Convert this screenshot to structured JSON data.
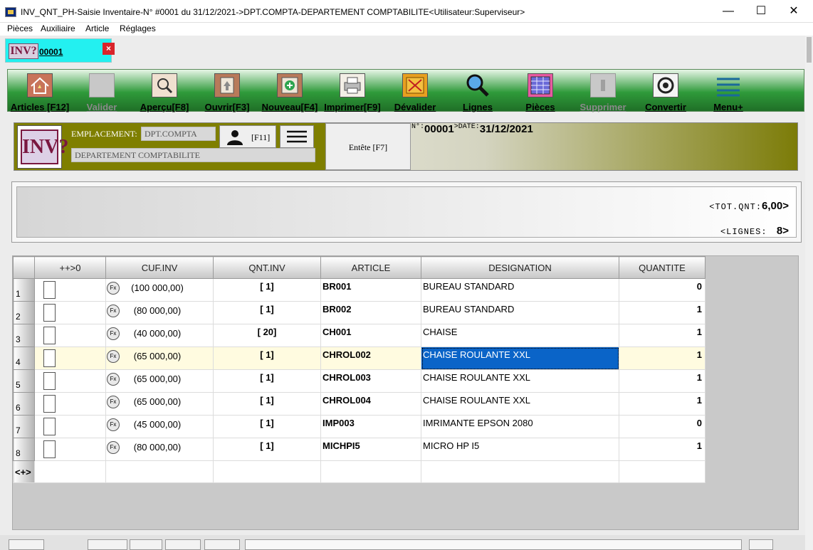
{
  "window": {
    "title": "INV_QNT_PH-Saisie Inventaire-N° #0001 du 31/12/2021->DPT.COMPTA-DEPARTEMENT COMPTABILITE<Utilisateur:Superviseur>",
    "minimize": "—",
    "maximize": "☐",
    "close": "✕"
  },
  "menu": [
    "Pièces",
    "Auxiliaire",
    "Article",
    "Réglages"
  ],
  "doc_tab": {
    "badge": "INV?",
    "number": "00001",
    "close": "×"
  },
  "toolbar": [
    {
      "label": "Articles [F12]",
      "icon": "house-icon",
      "enabled": true
    },
    {
      "label": "Valider",
      "icon": "validate-icon",
      "enabled": false
    },
    {
      "label": "Aperçu[F8]",
      "icon": "preview-icon",
      "enabled": true
    },
    {
      "label": "Ouvrir[F3]",
      "icon": "open-icon",
      "enabled": true
    },
    {
      "label": "Nouveau[F4]",
      "icon": "new-icon",
      "enabled": true
    },
    {
      "label": "Imprimer[F9]",
      "icon": "printer-icon",
      "enabled": true
    },
    {
      "label": "Dévalider",
      "icon": "unvalidate-icon",
      "enabled": true
    },
    {
      "label": "Lignes",
      "icon": "magnifier-icon",
      "enabled": true
    },
    {
      "label": "Pièces",
      "icon": "documents-icon",
      "enabled": true
    },
    {
      "label": "Supprimer",
      "icon": "trash-icon",
      "enabled": false
    },
    {
      "label": "Convertir",
      "icon": "convert-icon",
      "enabled": true
    },
    {
      "label": "Menu+",
      "icon": "menu-lines-icon",
      "enabled": true
    }
  ],
  "header": {
    "logo": "INV?",
    "emplacement_label": "EMPLACEMENT:",
    "emplacement_value": "DPT.COMPTA",
    "emplacement_desc": "DEPARTEMENT COMPTABILITE",
    "user_shortcut": "[F11]",
    "entete_button": "Entête [F7]",
    "num_label": "N°:",
    "num_value": "00001",
    "date_label": ">DATE:",
    "date_value": "31/12/2021"
  },
  "totals": {
    "tot_qnt_label": "<TOT.QNT:",
    "tot_qnt_value": "6,00>",
    "lignes_label": "<LIGNES:",
    "lignes_value": "8>"
  },
  "grid": {
    "columns": [
      "++>0",
      "CUF.INV",
      "QNT.INV",
      "ARTICLE",
      "DESIGNATION",
      "QUANTITE"
    ],
    "rows": [
      {
        "n": "1",
        "cuf": "(100 000,00)",
        "qnt": "[ 1]",
        "article": "BR001",
        "designation": "BUREAU STANDARD",
        "quantite": "0"
      },
      {
        "n": "2",
        "cuf": "(80 000,00)",
        "qnt": "[ 1]",
        "article": "BR002",
        "designation": "BUREAU STANDARD",
        "quantite": "1"
      },
      {
        "n": "3",
        "cuf": "(40 000,00)",
        "qnt": "[ 20]",
        "article": "CH001",
        "designation": "CHAISE",
        "quantite": "1"
      },
      {
        "n": "4",
        "cuf": "(65 000,00)",
        "qnt": "[ 1]",
        "article": "CHROL002",
        "designation": "CHAISE ROULANTE XXL",
        "quantite": "1"
      },
      {
        "n": "5",
        "cuf": "(65 000,00)",
        "qnt": "[ 1]",
        "article": "CHROL003",
        "designation": "CHAISE ROULANTE XXL",
        "quantite": "1"
      },
      {
        "n": "6",
        "cuf": "(65 000,00)",
        "qnt": "[ 1]",
        "article": "CHROL004",
        "designation": "CHAISE ROULANTE XXL",
        "quantite": "1"
      },
      {
        "n": "7",
        "cuf": "(45 000,00)",
        "qnt": "[ 1]",
        "article": "IMP003",
        "designation": "IMRIMANTE EPSON 2080",
        "quantite": "0"
      },
      {
        "n": "8",
        "cuf": "(80 000,00)",
        "qnt": "[ 1]",
        "article": "MICHPI5",
        "designation": "MICRO HP I5",
        "quantite": "1"
      }
    ],
    "selected_row": 3,
    "footer_label": "<+>",
    "fx_label": "Fx"
  },
  "colors": {
    "tab_bg": "#23f0f0",
    "toolbar_green": "#2f9a3a",
    "header_olive": "#7f7f00",
    "selection_blue": "#0a64c8"
  }
}
